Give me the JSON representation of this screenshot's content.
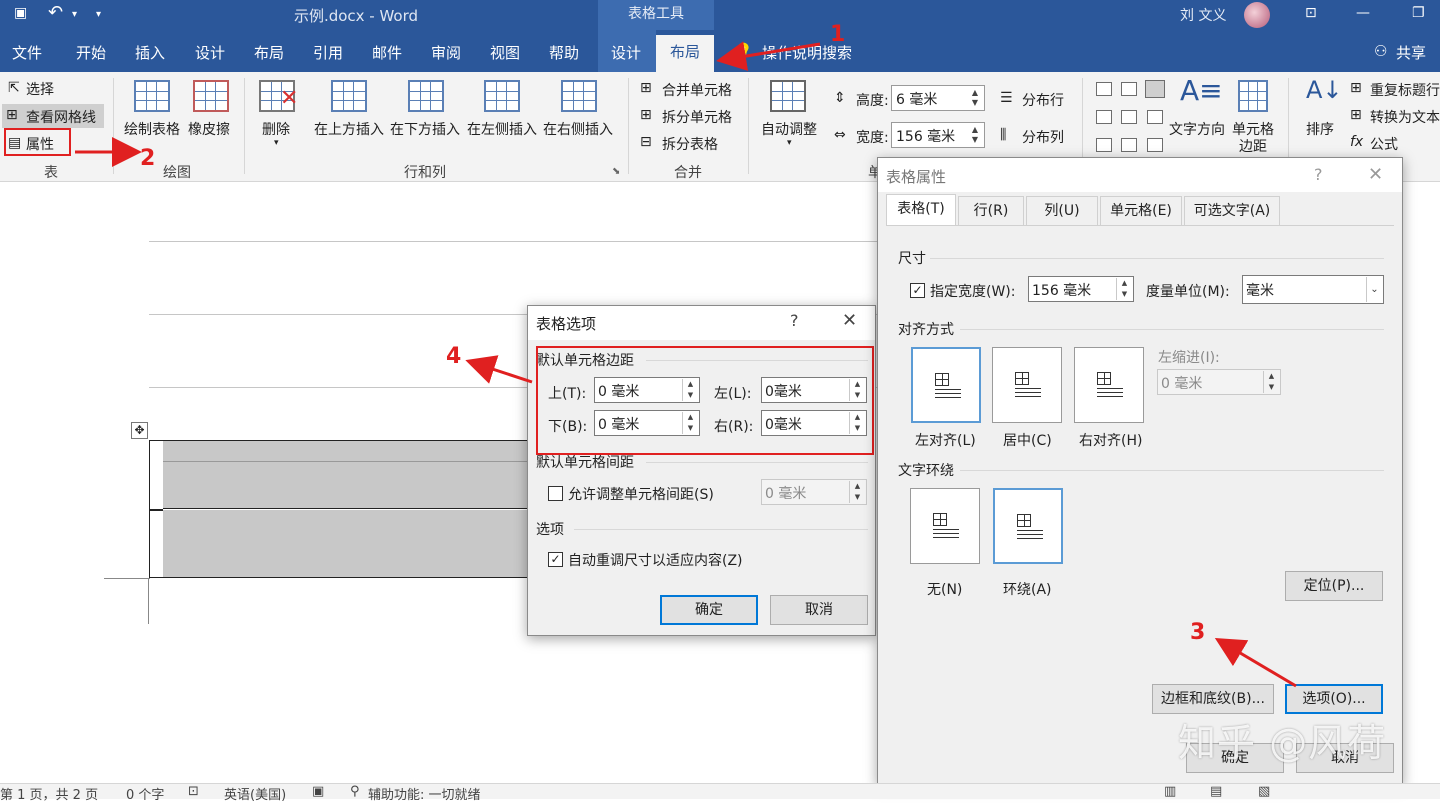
{
  "titlebar": {
    "doc_title": "示例.docx  -  Word",
    "tools_title": "表格工具",
    "username": "刘 文义",
    "undo_glyph": "↶",
    "dropdown_glyph": "▾"
  },
  "tabs": {
    "file": "文件",
    "home": "开始",
    "insert": "插入",
    "design": "设计",
    "layout_doc": "布局",
    "references": "引用",
    "mailings": "邮件",
    "review": "审阅",
    "view": "视图",
    "help": "帮助",
    "table_design": "设计",
    "table_layout": "布局",
    "tell_me": "操作说明搜索",
    "share": "共享"
  },
  "ribbon": {
    "table_group": {
      "select": "选择",
      "view_gridlines": "查看网格线",
      "properties": "属性",
      "label": "表"
    },
    "draw_group": {
      "draw_table": "绘制表格",
      "eraser": "橡皮擦",
      "label": "绘图"
    },
    "rows_cols_group": {
      "delete": "删除",
      "insert_above": "在上方插入",
      "insert_below": "在下方插入",
      "insert_left": "在左侧插入",
      "insert_right": "在右侧插入",
      "label": "行和列"
    },
    "merge_group": {
      "merge_cells": "合并单元格",
      "split_cells": "拆分单元格",
      "split_table": "拆分表格",
      "label": "合并"
    },
    "cell_size_group": {
      "autofit": "自动调整",
      "height_label": "高度:",
      "height_value": "6 毫米",
      "width_label": "宽度:",
      "width_value": "156 毫米",
      "distribute_rows": "分布行",
      "distribute_cols": "分布列",
      "label_partial": "单"
    },
    "alignment_group": {
      "text_direction": "文字方向",
      "cell_margins_1": "单元格",
      "cell_margins_2": "边距"
    },
    "data_group": {
      "sort": "排序",
      "repeat_header": "重复标题行",
      "convert_text": "转换为文本",
      "formula": "公式"
    }
  },
  "table_properties_dialog": {
    "title": "表格属性",
    "help": "?",
    "close": "✕",
    "tabs": [
      "表格(T)",
      "行(R)",
      "列(U)",
      "单元格(E)",
      "可选文字(A)"
    ],
    "size_section": "尺寸",
    "preferred_width_checked": true,
    "preferred_width_label": "指定宽度(W):",
    "preferred_width_value": "156 毫米",
    "measure_in_label": "度量单位(M):",
    "measure_in_value": "毫米",
    "alignment_section": "对齐方式",
    "align_left": "左对齐(L)",
    "align_center": "居中(C)",
    "align_right": "右对齐(H)",
    "indent_label": "左缩进(I):",
    "indent_value": "0 毫米",
    "wrapping_section": "文字环绕",
    "wrap_none": "无(N)",
    "wrap_around": "环绕(A)",
    "positioning": "定位(P)...",
    "borders_shading": "边框和底纹(B)...",
    "options": "选项(O)...",
    "ok": "确定",
    "cancel": "取消"
  },
  "table_options_dialog": {
    "title": "表格选项",
    "help": "?",
    "close": "✕",
    "default_margins_section": "默认单元格边距",
    "top_label": "上(T):",
    "top_value": "0 毫米",
    "left_label": "左(L):",
    "left_value": "0毫米",
    "bottom_label": "下(B):",
    "bottom_value": "0 毫米",
    "right_label": "右(R):",
    "right_value": "0毫米",
    "spacing_section": "默认单元格间距",
    "allow_spacing_checked": false,
    "allow_spacing_label": "允许调整单元格间距(S)",
    "spacing_value": "0 毫米",
    "options_section": "选项",
    "autoresize_checked": true,
    "autoresize_label": "自动重调尺寸以适应内容(Z)",
    "ok": "确定",
    "cancel": "取消"
  },
  "annotations": {
    "n1": "1",
    "n2": "2",
    "n3": "3",
    "n4": "4"
  },
  "statusbar": {
    "page": "第 1 页，共 2 页",
    "words": "0 个字",
    "language": "英语(美国)",
    "accessibility": "辅助功能: 一切就绪"
  },
  "watermark": "知乎 @风荷",
  "colors": {
    "accent": "#2b579a",
    "annotation": "#e02020",
    "dialog_bg": "#f0f0f0",
    "focus": "#0078d7"
  }
}
